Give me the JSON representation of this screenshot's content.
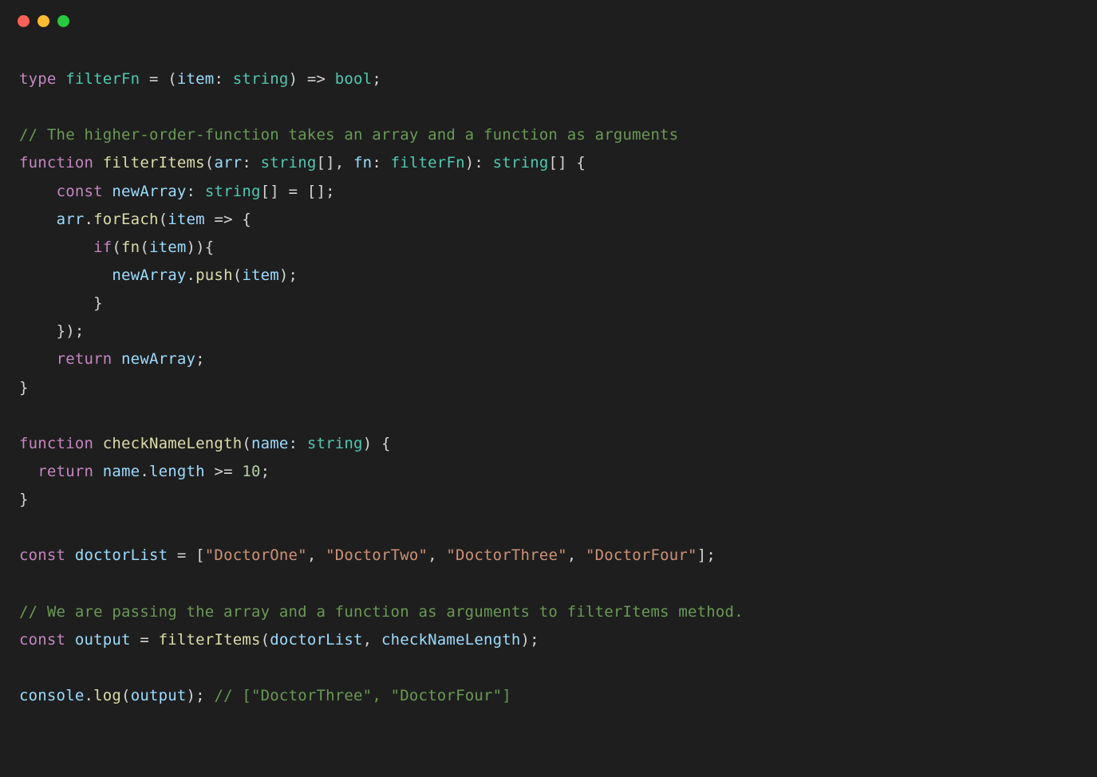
{
  "window": {
    "traffic_lights": [
      "red",
      "yellow",
      "green"
    ]
  },
  "code": {
    "line1_type": "type",
    "line1_name": "filterFn",
    "line1_eq": " = (",
    "line1_param": "item",
    "line1_colon": ": ",
    "line1_ptype": "string",
    "line1_arrow": ") => ",
    "line1_ret": "bool",
    "line1_semi": ";",
    "line3_comment": "// The higher-order-function takes an array and a function as arguments",
    "line4_fn": "function",
    "line4_name": "filterItems",
    "line4_open": "(",
    "line4_p1": "arr",
    "line4_p1c": ": ",
    "line4_p1t": "string",
    "line4_p1b": "[], ",
    "line4_p2": "fn",
    "line4_p2c": ": ",
    "line4_p2t": "filterFn",
    "line4_close": "): ",
    "line4_rett": "string",
    "line4_retb": "[] {",
    "line5_indent": "    ",
    "line5_const": "const",
    "line5_sp": " ",
    "line5_var": "newArray",
    "line5_c": ": ",
    "line5_t": "string",
    "line5_rest": "[] = [];",
    "line6_indent": "    ",
    "line6_arr": "arr",
    "line6_dot": ".",
    "line6_forEach": "forEach",
    "line6_open": "(",
    "line6_item": "item",
    "line6_arrow": " => {",
    "line7_indent": "        ",
    "line7_if": "if",
    "line7_open": "(",
    "line7_fn": "fn",
    "line7_op2": "(",
    "line7_item": "item",
    "line7_close": ")){",
    "line8_indent": "          ",
    "line8_na": "newArray",
    "line8_dot": ".",
    "line8_push": "push",
    "line8_open": "(",
    "line8_item": "item",
    "line8_close": ");",
    "line9_indent": "        ",
    "line9_brace": "}",
    "line10_indent": "    ",
    "line10_close": "});",
    "line11_indent": "    ",
    "line11_ret": "return",
    "line11_sp": " ",
    "line11_var": "newArray",
    "line11_semi": ";",
    "line12_brace": "}",
    "line14_fn": "function",
    "line14_name": "checkNameLength",
    "line14_open": "(",
    "line14_p": "name",
    "line14_c": ": ",
    "line14_t": "string",
    "line14_close": ") {",
    "line15_indent": "  ",
    "line15_ret": "return",
    "line15_sp": " ",
    "line15_name": "name",
    "line15_dot": ".",
    "line15_len": "length",
    "line15_op": " >= ",
    "line15_num": "10",
    "line15_semi": ";",
    "line16_brace": "}",
    "line18_const": "const",
    "line18_sp": " ",
    "line18_var": "doctorList",
    "line18_eq": " = [",
    "line18_s1": "\"DoctorOne\"",
    "line18_c1": ", ",
    "line18_s2": "\"DoctorTwo\"",
    "line18_c2": ", ",
    "line18_s3": "\"DoctorThree\"",
    "line18_c3": ", ",
    "line18_s4": "\"DoctorFour\"",
    "line18_close": "];",
    "line20_comment": "// We are passing the array and a function as arguments to filterItems method.",
    "line21_const": "const",
    "line21_sp": " ",
    "line21_var": "output",
    "line21_eq": " = ",
    "line21_fn": "filterItems",
    "line21_open": "(",
    "line21_a1": "doctorList",
    "line21_c": ", ",
    "line21_a2": "checkNameLength",
    "line21_close": ");",
    "line23_console": "console",
    "line23_dot": ".",
    "line23_log": "log",
    "line23_open": "(",
    "line23_arg": "output",
    "line23_close": "); ",
    "line23_comment": "// [\"DoctorThree\", \"DoctorFour\"]"
  }
}
